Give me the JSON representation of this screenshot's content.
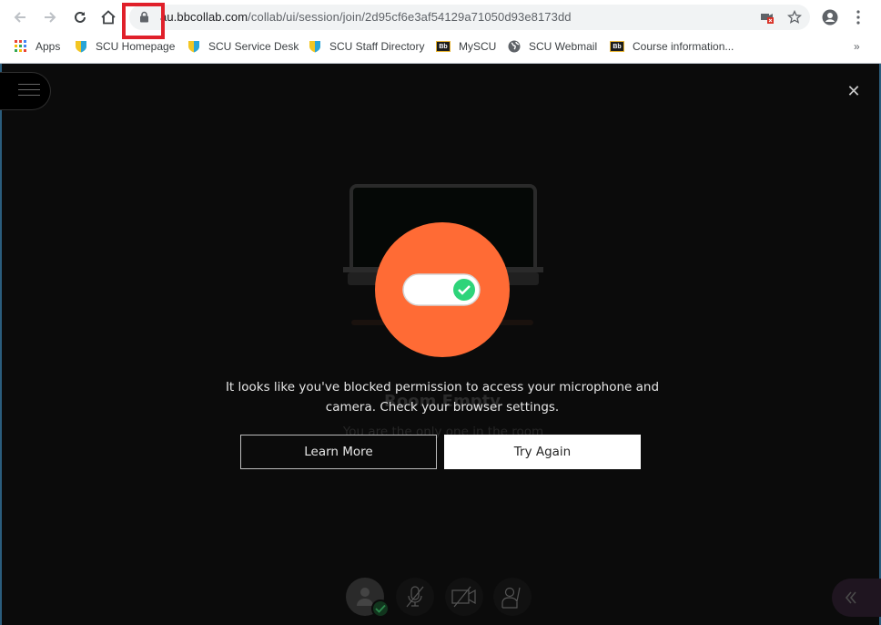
{
  "browser": {
    "url_host": "au.bbcollab.com",
    "url_path": "/collab/ui/session/join/2d95cf6e3af54129a71050d93e8173dd",
    "icons": {
      "back": "arrow-left-icon",
      "forward": "arrow-right-icon",
      "reload": "reload-icon",
      "home": "home-icon",
      "lock": "lock-icon",
      "camera_blocked": "camera-blocked-icon",
      "bookmark_star": "star-icon",
      "profile": "account-circle-icon",
      "menu": "more-vertical-icon"
    },
    "bookmarks": [
      {
        "label": "Apps",
        "icon": "apps-grid-icon"
      },
      {
        "label": "SCU Homepage",
        "icon": "scu-shield-icon"
      },
      {
        "label": "SCU Service Desk",
        "icon": "scu-shield-icon"
      },
      {
        "label": "SCU Staff Directory",
        "icon": "scu-shield-icon"
      },
      {
        "label": "MySCU",
        "icon": "blackboard-icon"
      },
      {
        "label": "SCU Webmail",
        "icon": "globe-icon"
      },
      {
        "label": "Course information...",
        "icon": "blackboard-icon"
      }
    ],
    "bookmarks_overflow": "»",
    "bb_badge": "Bb"
  },
  "app": {
    "close_glyph": "✕",
    "background": {
      "title": "Room Empty",
      "subtitle": "You are the only one in the room"
    },
    "dialog": {
      "message": "It looks like you've blocked permission to access your microphone and camera. Check your browser settings.",
      "learn_more": "Learn More",
      "try_again": "Try Again",
      "accent_color": "#ff6b35",
      "toggle_check_color": "#2ed47a"
    },
    "controls": [
      {
        "name": "avatar-status",
        "icon": "user-avatar-icon"
      },
      {
        "name": "microphone-toggle",
        "icon": "microphone-off-icon"
      },
      {
        "name": "camera-toggle",
        "icon": "camera-off-icon"
      },
      {
        "name": "raise-hand",
        "icon": "raise-hand-icon"
      }
    ],
    "panel_toggle_glyph": "«"
  }
}
